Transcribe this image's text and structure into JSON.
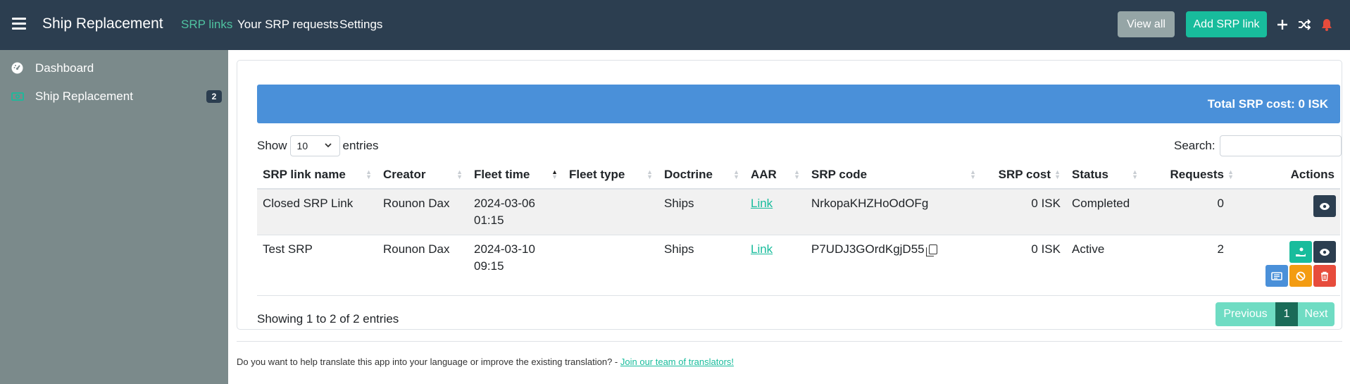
{
  "header": {
    "brand": "Ship Replacement",
    "nav": [
      "SRP links",
      "Your SRP requests",
      "Settings"
    ],
    "view_all": "View all",
    "add_srp": "Add SRP link"
  },
  "sidebar": {
    "items": [
      {
        "label": "Dashboard",
        "icon": "dashboard-icon"
      },
      {
        "label": "Ship Replacement",
        "icon": "money-icon",
        "badge": "2"
      }
    ]
  },
  "summary": {
    "total": "Total SRP cost: 0 ISK"
  },
  "table_controls": {
    "show": "Show",
    "entries_value": "10",
    "entries": "entries",
    "search_label": "Search:"
  },
  "table": {
    "columns": [
      "SRP link name",
      "Creator",
      "Fleet time",
      "Fleet type",
      "Doctrine",
      "AAR",
      "SRP code",
      "SRP cost",
      "Status",
      "Requests",
      "Actions"
    ],
    "rows": [
      {
        "name": "Closed SRP Link",
        "creator": "Rounon Dax",
        "fleet_time": "2024-03-06 01:15",
        "fleet_type": "",
        "doctrine": "Ships",
        "aar": "Link",
        "code": "NrkopaKHZHoOdOFg",
        "cost": "0 ISK",
        "status": "Completed",
        "requests": "0"
      },
      {
        "name": "Test SRP",
        "creator": "Rounon Dax",
        "fleet_time": "2024-03-10 09:15",
        "fleet_type": "",
        "doctrine": "Ships",
        "aar": "Link",
        "code": "P7UDJ3GOrdKgjD55",
        "cost": "0 ISK",
        "status": "Active",
        "requests": "2"
      }
    ]
  },
  "pagination": {
    "info": "Showing 1 to 2 of 2 entries",
    "previous": "Previous",
    "page": "1",
    "next": "Next"
  },
  "footer": {
    "text": "Do you want to help translate this app into your language or improve the existing translation? - ",
    "link": "Join our team of translators!"
  }
}
